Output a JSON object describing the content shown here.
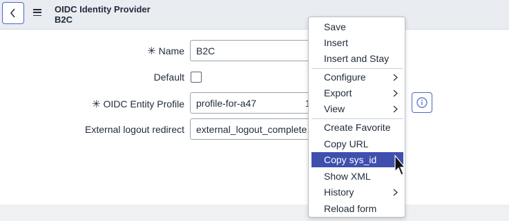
{
  "header": {
    "title_line1": "OIDC Identity Provider",
    "title_line2": "B2C"
  },
  "form": {
    "name_label": "Name",
    "name_value": "B2C",
    "default_label": "Default",
    "entity_profile_label": "OIDC Entity Profile",
    "entity_profile_value": "profile-for-a47",
    "entity_profile_suffix": "1",
    "logout_label": "External logout redirect",
    "logout_value": "external_logout_complete."
  },
  "menu": {
    "items": [
      {
        "label": "Save"
      },
      {
        "label": "Insert"
      },
      {
        "label": "Insert and Stay"
      },
      {
        "label": "Configure"
      },
      {
        "label": "Export"
      },
      {
        "label": "View"
      },
      {
        "label": "Create Favorite"
      },
      {
        "label": "Copy URL"
      },
      {
        "label": "Copy sys_id"
      },
      {
        "label": "Show XML"
      },
      {
        "label": "History"
      },
      {
        "label": "Reload form"
      }
    ],
    "highlighted": "Copy sys_id"
  },
  "icons": {
    "back": "chevron-left-icon",
    "menu": "hamburger-icon",
    "info": "info-icon",
    "submenu": "chevron-right-icon",
    "cursor": "mouse-pointer-icon"
  },
  "colors": {
    "accent": "#3f4fae",
    "header_bg": "#e9ecf0",
    "border_accent": "#4b64c8"
  }
}
